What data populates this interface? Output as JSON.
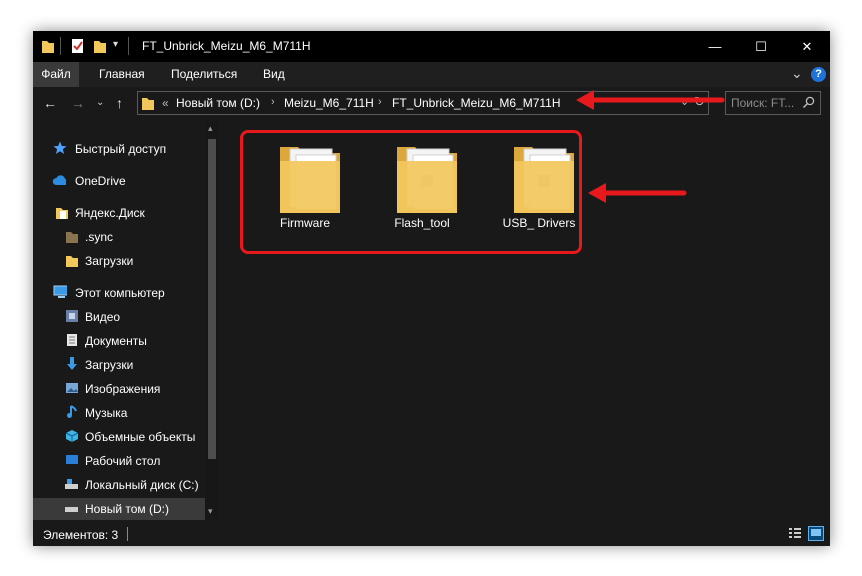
{
  "window": {
    "title": "FT_Unbrick_Meizu_M6_M711H",
    "minimize_glyph": "—",
    "maximize_glyph": "☐",
    "close_glyph": "✕"
  },
  "ribbon": {
    "tabs": [
      {
        "label": "Файл"
      },
      {
        "label": "Главная"
      },
      {
        "label": "Поделиться"
      },
      {
        "label": "Вид"
      }
    ],
    "expand_glyph": "⌄",
    "help_glyph": "?"
  },
  "address": {
    "overflow": "«",
    "crumbs": [
      "Новый том (D:)",
      "Meizu_M6_711H",
      "FT_Unbrick_Meizu_M6_M711H"
    ],
    "separator": "›"
  },
  "search": {
    "placeholder": "Поиск: FT..."
  },
  "nav": {
    "items": [
      {
        "label": "Быстрый доступ",
        "icon": "star-icon"
      },
      {
        "label": "OneDrive",
        "icon": "cloud-icon"
      },
      {
        "label": "Яндекс.Диск",
        "icon": "folder-icon"
      },
      {
        "label": ".sync",
        "icon": "folder-icon"
      },
      {
        "label": "Загрузки",
        "icon": "folder-icon"
      },
      {
        "label": "Этот компьютер",
        "icon": "computer-icon"
      },
      {
        "label": "Видео",
        "icon": "video-icon"
      },
      {
        "label": "Документы",
        "icon": "documents-icon"
      },
      {
        "label": "Загрузки",
        "icon": "download-icon"
      },
      {
        "label": "Изображения",
        "icon": "pictures-icon"
      },
      {
        "label": "Музыка",
        "icon": "music-icon"
      },
      {
        "label": "Объемные объекты",
        "icon": "3d-objects-icon"
      },
      {
        "label": "Рабочий стол",
        "icon": "desktop-icon"
      },
      {
        "label": "Локальный диск (C:)",
        "icon": "drive-icon"
      },
      {
        "label": "Новый том (D:)",
        "icon": "drive-icon",
        "selected": true
      }
    ]
  },
  "content": {
    "folders": [
      {
        "name": "Firmware"
      },
      {
        "name": "Flash_tool"
      },
      {
        "name": "USB_ Drivers"
      }
    ]
  },
  "status": {
    "items_count": "Элементов: 3"
  },
  "colors": {
    "window_bg": "#191919",
    "titlebar_bg": "#000000",
    "selection": "#3a3a3a",
    "annotation": "#e8191c",
    "folder": "#f2c75c"
  }
}
